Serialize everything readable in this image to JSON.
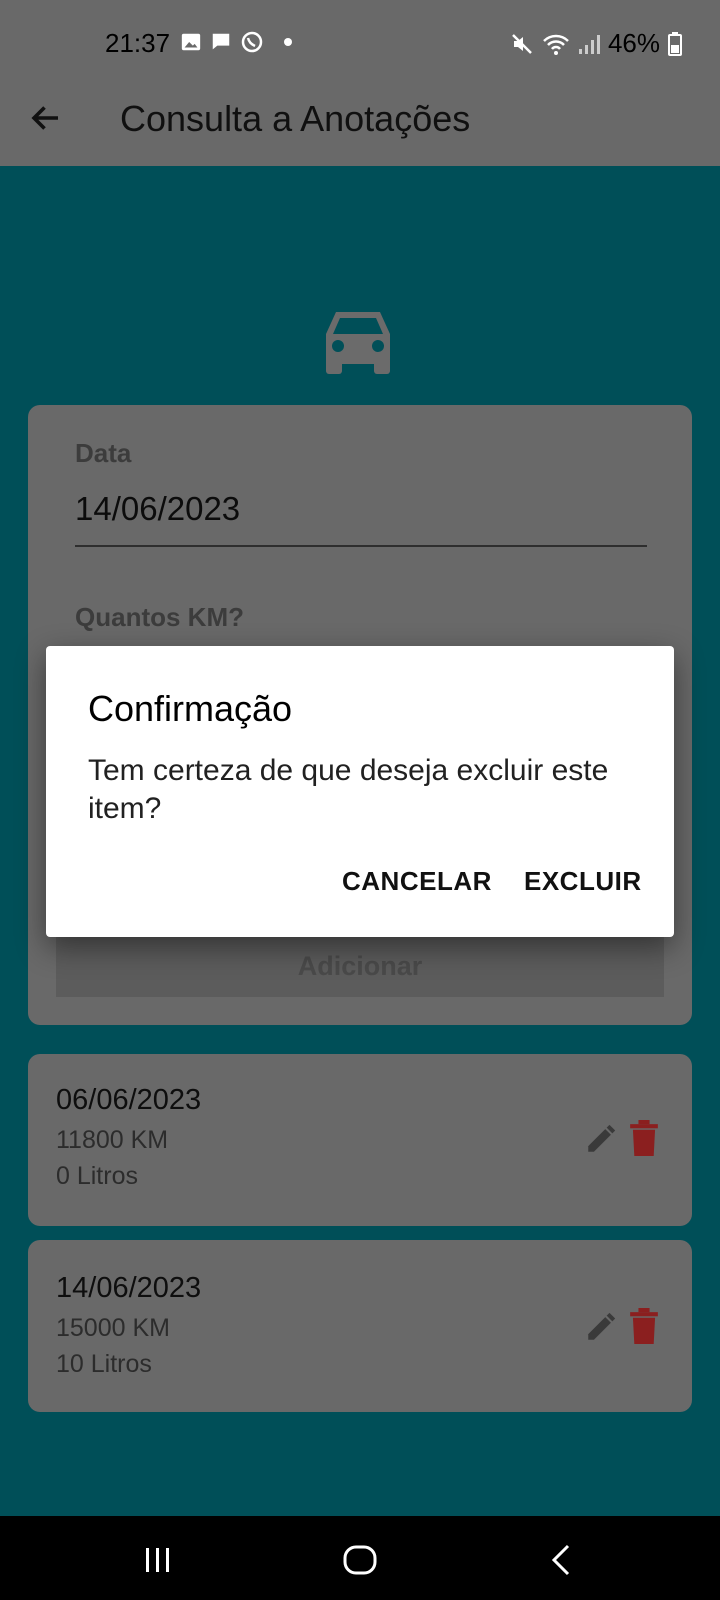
{
  "status_bar": {
    "time": "21:37",
    "battery": "46%",
    "icons_left": [
      "gallery-icon",
      "message-icon",
      "whatsapp-icon",
      "dot-icon"
    ],
    "icons_right": [
      "mute-icon",
      "wifi-icon",
      "signal-icon",
      "battery-icon"
    ]
  },
  "app_bar": {
    "title": "Consulta a Anotações"
  },
  "form": {
    "data_label": "Data",
    "data_value": "14/06/2023",
    "km_label": "Quantos KM?",
    "add_button": "Adicionar"
  },
  "items": [
    {
      "date": "06/06/2023",
      "km": "11800 KM",
      "liters": "0 Litros"
    },
    {
      "date": "14/06/2023",
      "km": "15000 KM",
      "liters": "10 Litros"
    }
  ],
  "dialog": {
    "title": "Confirmação",
    "message": "Tem certeza de que deseja excluir este item?",
    "cancel": "CANCELAR",
    "confirm": "EXCLUIR"
  },
  "colors": {
    "accent_bg": "#004f58",
    "delete_red": "#8b1f1f",
    "scrim_gray": "#696969"
  }
}
